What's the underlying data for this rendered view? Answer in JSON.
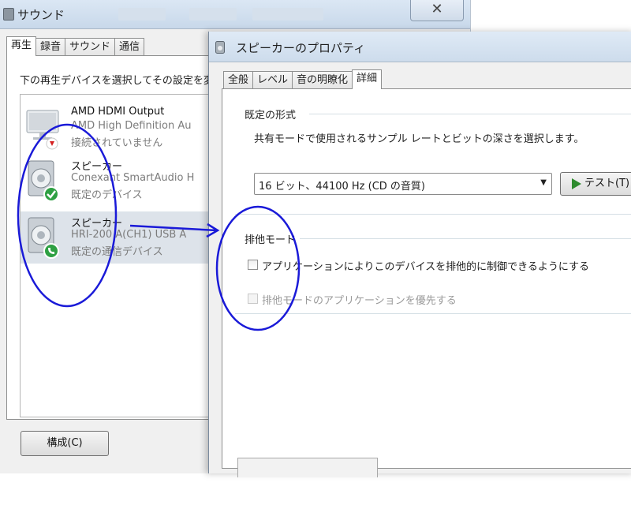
{
  "sound_window": {
    "title": "サウンド",
    "close_glyph": "✕",
    "tabs": [
      {
        "label": "再生",
        "active": true
      },
      {
        "label": "録音",
        "active": false
      },
      {
        "label": "サウンド",
        "active": false
      },
      {
        "label": "通信",
        "active": false
      }
    ],
    "instruction": "下の再生デバイスを選択してその設定を変",
    "devices": [
      {
        "name": "AMD HDMI Output",
        "desc": "AMD High Definition Au",
        "status": "接続されていません",
        "badge": "disconnected"
      },
      {
        "name": "スピーカー",
        "desc": "Conexant SmartAudio H",
        "status": "既定のデバイス",
        "badge": "default"
      },
      {
        "name": "スピーカー",
        "desc": "HRI-200 A(CH1) USB A",
        "status": "既定の通信デバイス",
        "badge": "communication"
      }
    ],
    "configure_label": "構成(C)"
  },
  "props_window": {
    "title": "スピーカーのプロパティ",
    "tabs": [
      {
        "label": "全般",
        "active": false
      },
      {
        "label": "レベル",
        "active": false
      },
      {
        "label": "音の明瞭化",
        "active": false
      },
      {
        "label": "詳細",
        "active": true
      }
    ],
    "default_format": {
      "title": "既定の形式",
      "description": "共有モードで使用されるサンプル レートとビットの深さを選択します。",
      "selected": "16 ビット、44100 Hz (CD の音質)",
      "test_label": "テスト(T)"
    },
    "exclusive_mode": {
      "title": "排他モード",
      "allow_label": "アプリケーションによりこのデバイスを排他的に制御できるようにする",
      "allow_checked": false,
      "priority_label": "排他モードのアプリケーションを優先する",
      "priority_checked": false,
      "priority_enabled": false
    }
  },
  "colors": {
    "annotation": "#1a1ad8",
    "check_green": "#2ea043",
    "disconnected_red": "#d42020"
  }
}
